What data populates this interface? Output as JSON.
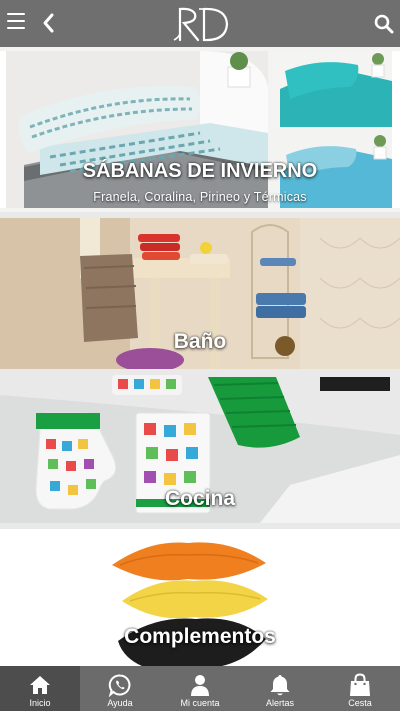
{
  "header": {
    "menu_icon": "hamburger-menu-icon",
    "back_icon": "chevron-left-icon",
    "logo_text": "RD",
    "search_icon": "search-icon"
  },
  "categories": [
    {
      "title": "SÁBANAS DE INVIERNO",
      "subtitle": "Franela, Coralina, Pirineo y Térmicas"
    },
    {
      "title": "Baño"
    },
    {
      "title": "Cocina"
    },
    {
      "title": "Complementos"
    }
  ],
  "bottom_nav": [
    {
      "label": "Inicio",
      "icon": "home-icon",
      "active": true
    },
    {
      "label": "Ayuda",
      "icon": "whatsapp-icon"
    },
    {
      "label": "Mi cuenta",
      "icon": "user-icon"
    },
    {
      "label": "Alertas",
      "icon": "bell-icon"
    },
    {
      "label": "Cesta",
      "icon": "shopping-bag-icon"
    }
  ],
  "colors": {
    "header_bg": "#6f6f6f",
    "nav_bg": "#6b6b6b",
    "nav_active_bg": "#4d4d4d"
  }
}
